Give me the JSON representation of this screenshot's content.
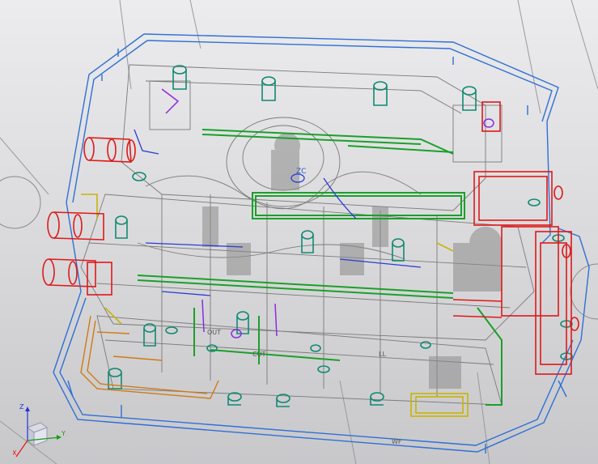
{
  "viewport": {
    "background_top": "#ececee",
    "background_bottom": "#c8c8cb"
  },
  "model": {
    "origin_label": "ZC",
    "small_labels": [
      "OUT",
      "CUT",
      "LL",
      "WF"
    ],
    "colors": {
      "plate_outline": "#2f6fd6",
      "wireframe": "#7a7a7a",
      "cooling_lines": "#1aa02a",
      "fasteners": "#0f8a72",
      "cylinders": "#e01818",
      "slide_block": "#d07a12",
      "ejector": "#c8b400",
      "core": "#7a7a7a",
      "accent_purple": "#8a2be2",
      "accent_blue": "#2a3bd8"
    }
  },
  "triad": {
    "x_label": "X",
    "y_label": "Y",
    "z_label": "Z",
    "x_color": "#e11",
    "y_color": "#1a9a1a",
    "z_color": "#2233dd"
  }
}
